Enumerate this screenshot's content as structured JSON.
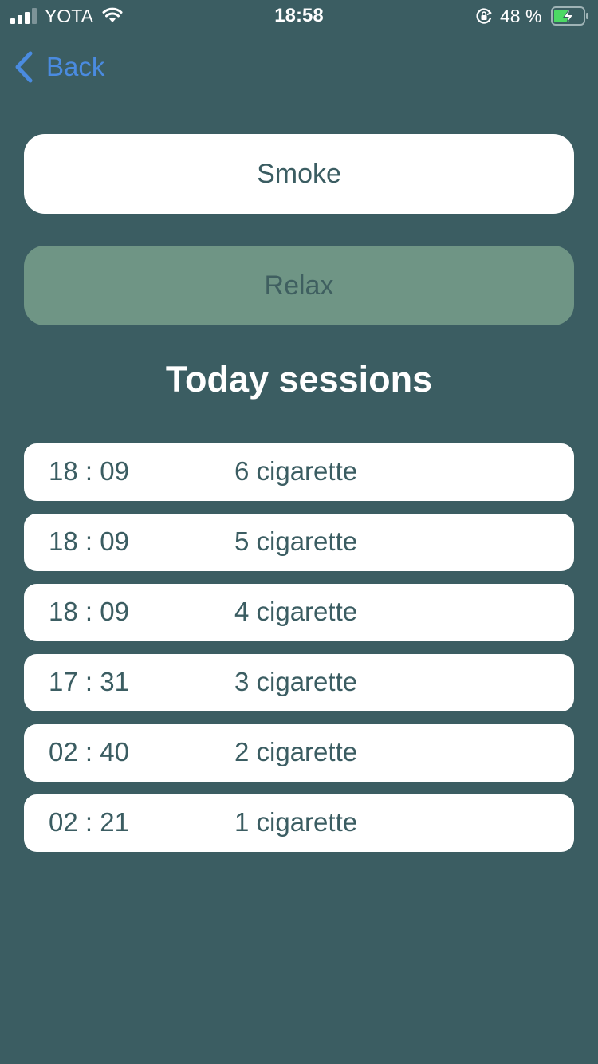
{
  "status_bar": {
    "carrier": "YOTA",
    "time": "18:58",
    "battery_percent": "48 %"
  },
  "nav": {
    "back_label": "Back"
  },
  "actions": {
    "smoke_label": "Smoke",
    "relax_label": "Relax"
  },
  "sessions": {
    "title": "Today sessions",
    "items": [
      {
        "time": "18 : 09",
        "label": "6 cigarette"
      },
      {
        "time": "18 : 09",
        "label": "5 cigarette"
      },
      {
        "time": "18 : 09",
        "label": "4 cigarette"
      },
      {
        "time": "17 : 31",
        "label": "3 cigarette"
      },
      {
        "time": "02 : 40",
        "label": "2 cigarette"
      },
      {
        "time": "02 : 21",
        "label": "1 cigarette"
      }
    ]
  },
  "colors": {
    "background": "#3b5d62",
    "accent": "#4a8be0",
    "relax_button": "#6f9585",
    "battery_charging": "#4cd964"
  },
  "icons": {
    "signal": "cellular-signal-icon",
    "wifi": "wifi-icon",
    "lock": "orientation-lock-icon",
    "battery": "battery-charging-icon",
    "back": "chevron-left-icon"
  }
}
